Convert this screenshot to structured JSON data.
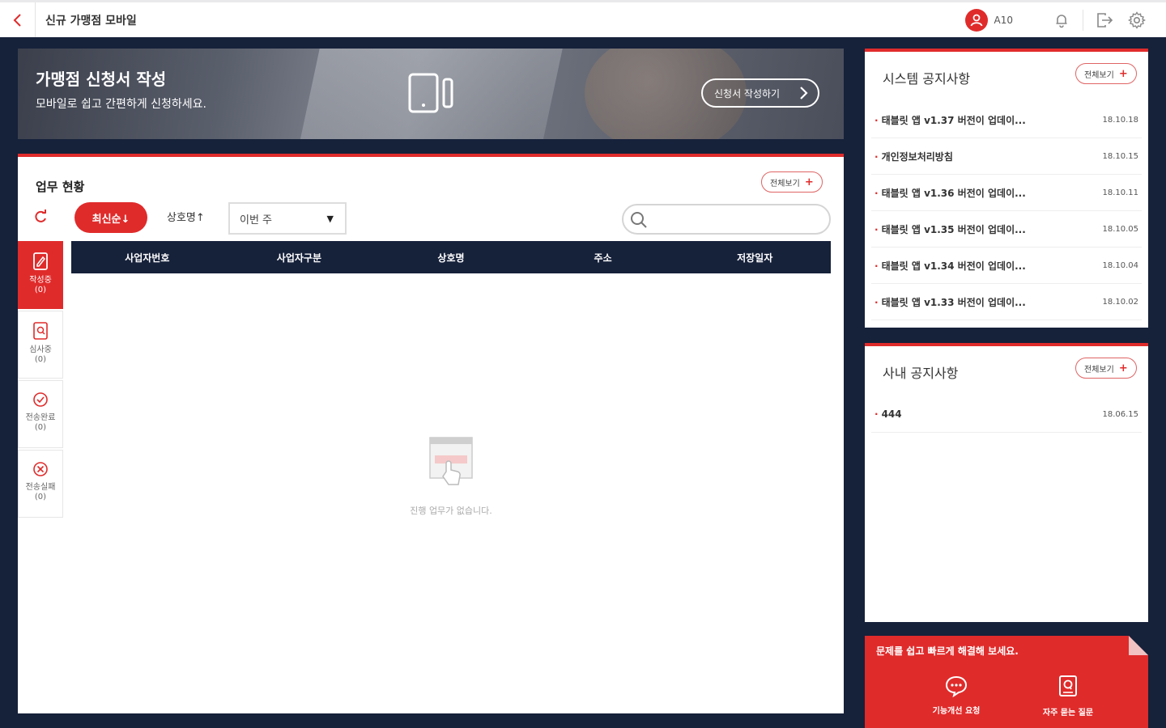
{
  "header": {
    "title": "신규 가맹점 모바일",
    "user_name": "A10"
  },
  "banner": {
    "title": "가맹점 신청서 작성",
    "subtitle": "모바일로 쉽고 간편하게 신청하세요.",
    "button_label": "신청서 작성하기"
  },
  "work": {
    "title": "업무 현황",
    "more_label": "전체보기",
    "sort_latest": "최신순↓",
    "sort_name": "상호명↑",
    "period": "이번 주",
    "search_placeholder": "",
    "status_tabs": [
      {
        "label": "작성중",
        "count": "(0)"
      },
      {
        "label": "심사중",
        "count": "(0)"
      },
      {
        "label": "전송완료",
        "count": "(0)"
      },
      {
        "label": "전송실패",
        "count": "(0)"
      }
    ],
    "columns": [
      "사업자번호",
      "사업자구분",
      "상호명",
      "주소",
      "저장일자"
    ],
    "empty_text": "진행 업무가 없습니다."
  },
  "system_notice": {
    "title": "시스템 공지사항",
    "more_label": "전체보기",
    "items": [
      {
        "title": "태블릿 앱 v1.37 버전이 업데이...",
        "date": "18.10.18"
      },
      {
        "title": "개인정보처리방침",
        "date": "18.10.15"
      },
      {
        "title": "태블릿 앱 v1.36 버전이 업데이...",
        "date": "18.10.11"
      },
      {
        "title": "태블릿 앱 v1.35 버전이 업데이...",
        "date": "18.10.05"
      },
      {
        "title": "태블릿 앱 v1.34 버전이 업데이...",
        "date": "18.10.04"
      },
      {
        "title": "태블릿 앱 v1.33 버전이 업데이...",
        "date": "18.10.02"
      }
    ]
  },
  "internal_notice": {
    "title": "사내 공지사항",
    "more_label": "전체보기",
    "items": [
      {
        "title": "444",
        "date": "18.06.15"
      }
    ]
  },
  "help": {
    "text": "문제를 쉽고 빠르게 해결해 보세요.",
    "improve_label": "기능개선 요청",
    "faq_label": "자주 묻는 질문"
  },
  "colors": {
    "accent": "#e02b2b",
    "navy": "#16213a"
  }
}
